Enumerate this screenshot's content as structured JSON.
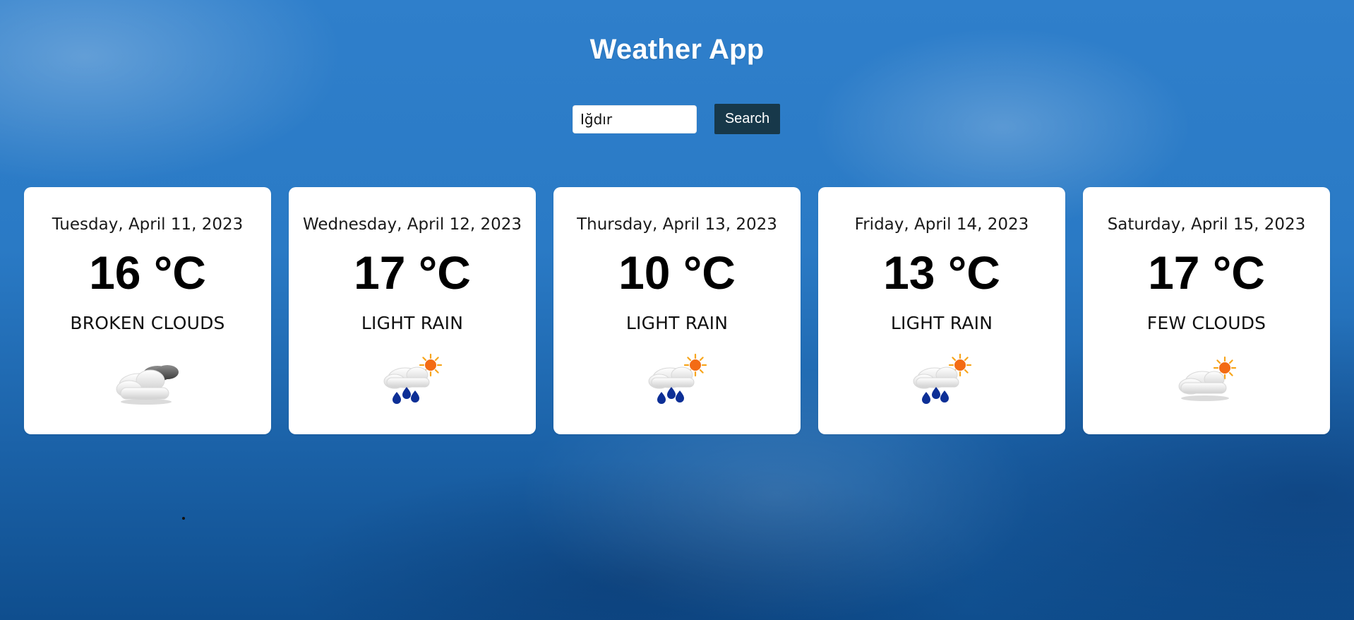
{
  "app": {
    "title": "Weather App"
  },
  "search": {
    "value": "Iğdır",
    "button_label": "Search"
  },
  "forecast": [
    {
      "date": "Tuesday, April 11, 2023",
      "temp": "16 °C",
      "description": "BROKEN CLOUDS",
      "icon": "broken-clouds-icon"
    },
    {
      "date": "Wednesday, April 12, 2023",
      "temp": "17 °C",
      "description": "LIGHT RAIN",
      "icon": "light-rain-icon"
    },
    {
      "date": "Thursday, April 13, 2023",
      "temp": "10 °C",
      "description": "LIGHT RAIN",
      "icon": "light-rain-icon"
    },
    {
      "date": "Friday, April 14, 2023",
      "temp": "13 °C",
      "description": "LIGHT RAIN",
      "icon": "light-rain-icon"
    },
    {
      "date": "Saturday, April 15, 2023",
      "temp": "17 °C",
      "description": "FEW CLOUDS",
      "icon": "few-clouds-icon"
    }
  ]
}
